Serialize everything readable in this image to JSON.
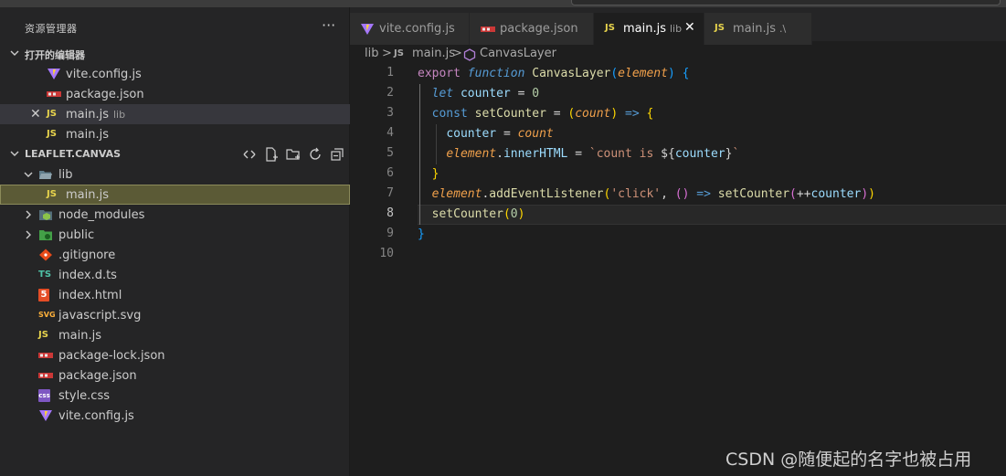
{
  "explorer": {
    "title": "资源管理器",
    "more": "···",
    "open_editors": {
      "title": "打开的编辑器",
      "items": [
        {
          "label": "vite.config.js",
          "sub": "",
          "icon": "vite-icon"
        },
        {
          "label": "package.json",
          "sub": "",
          "icon": "npm-icon"
        },
        {
          "label": "main.js",
          "sub": "lib",
          "icon": "js-icon",
          "close": "✕"
        },
        {
          "label": "main.js",
          "sub": "",
          "icon": "js-icon"
        }
      ]
    },
    "workspace": {
      "title": "LEAFLET.CANVAS",
      "tools": [
        "collapse-folders-icon",
        "new-file-icon",
        "new-folder-icon",
        "refresh-icon",
        "collapse-all-icon"
      ],
      "tree": [
        {
          "label": "lib",
          "type": "folder-open"
        },
        {
          "label": "main.js",
          "type": "js",
          "indent": 1
        },
        {
          "label": "node_modules",
          "type": "folder"
        },
        {
          "label": "public",
          "type": "folder"
        },
        {
          "label": ".gitignore",
          "type": "git"
        },
        {
          "label": "index.d.ts",
          "type": "ts"
        },
        {
          "label": "index.html",
          "type": "html"
        },
        {
          "label": "javascript.svg",
          "type": "svg"
        },
        {
          "label": "main.js",
          "type": "js"
        },
        {
          "label": "package-lock.json",
          "type": "npm"
        },
        {
          "label": "package.json",
          "type": "npm"
        },
        {
          "label": "style.css",
          "type": "css"
        },
        {
          "label": "vite.config.js",
          "type": "vite"
        }
      ]
    }
  },
  "icon_glyphs": {
    "js": "JS",
    "ts": "TS",
    "css": "css",
    "svg": "SVG",
    "html": "5"
  },
  "tabs": [
    {
      "label": "vite.config.js",
      "sub": ""
    },
    {
      "label": "package.json",
      "sub": ""
    },
    {
      "label": "main.js",
      "sub": "lib",
      "close": "✕"
    },
    {
      "label": "main.js",
      "sub": ".\\"
    }
  ],
  "breadcrumb": {
    "folder": "lib",
    "sep": ">",
    "file": "main.js",
    "symbol": "CanvasLayer"
  },
  "editor": {
    "line_numbers": [
      "1",
      "2",
      "3",
      "4",
      "5",
      "6",
      "7",
      "8",
      "9",
      "10"
    ],
    "current_line": "8"
  },
  "watermark": "CSDN @随便起的名字也被占用"
}
